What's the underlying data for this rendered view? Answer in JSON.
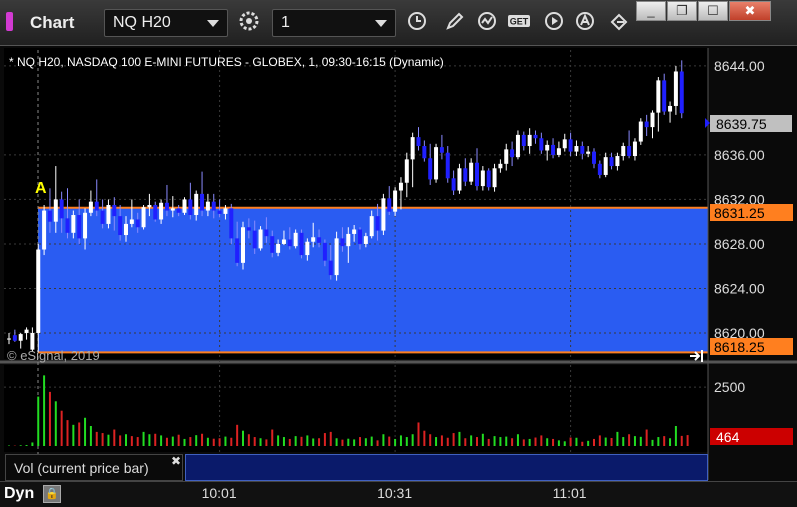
{
  "window": {
    "title": "Chart",
    "symbol": "NQ H20",
    "interval": "1",
    "buttons": [
      "_",
      "❐",
      "☐",
      "✖"
    ]
  },
  "chart": {
    "header": "* NQ H20, NASDAQ 100 E-MINI FUTURES - GLOBEX, 1, 09:30-16:15 (Dynamic)",
    "copyright": "© eSignal, 2019",
    "marker": "A",
    "last_price": "8639.75",
    "upper_level": "8631.25",
    "lower_level": "8618.25",
    "volume_label": "Vol (current price bar)",
    "volume_value": "464",
    "mode": "Dyn",
    "colors": {
      "up": "#ffffff",
      "down": "#2020ff",
      "band": "#2a5cf2",
      "level": "#ff7f1f",
      "vol_up": "#22dd22",
      "vol_down": "#dd2222",
      "last": "#c0c0c0"
    }
  },
  "chart_data": {
    "type": "candlestick",
    "price_axis": {
      "ticks": [
        8620,
        8624,
        8628,
        8632,
        8636,
        8644
      ],
      "labels": [
        "8620.00",
        "8624.00",
        "8628.00",
        "8632.00",
        "8636.00",
        "8644.00"
      ],
      "range": [
        8617.75,
        8645.25
      ]
    },
    "volume_axis": {
      "ticks": [
        2500
      ],
      "labels": [
        "2500"
      ],
      "range": [
        0,
        3400
      ]
    },
    "time_axis": {
      "labels": [
        "10:01",
        "10:31",
        "11:01"
      ],
      "bar_index": [
        36,
        66,
        96
      ]
    },
    "bars": [
      [
        8619.5,
        8620,
        8619,
        8619.5
      ],
      [
        8619.8,
        8620.3,
        8619.2,
        8619.3
      ],
      [
        8619.3,
        8620,
        8618.6,
        8619.9
      ],
      [
        8620,
        8620.5,
        8619.4,
        8620.3
      ],
      [
        8618.5,
        8620.5,
        8618.3,
        8620
      ],
      [
        8620,
        8628,
        8618.25,
        8627.5
      ],
      [
        8627.5,
        8631.5,
        8627,
        8631
      ],
      [
        8631,
        8633,
        8629,
        8630
      ],
      [
        8630,
        8635,
        8629,
        8632
      ],
      [
        8632,
        8632.7,
        8629,
        8630.3
      ],
      [
        8630.3,
        8633,
        8628.5,
        8629
      ],
      [
        8629,
        8631,
        8628.5,
        8630.6
      ],
      [
        8630.6,
        8632,
        8628,
        8628.5
      ],
      [
        8628.5,
        8631.2,
        8627.5,
        8630.8
      ],
      [
        8630.8,
        8632.8,
        8630.5,
        8631.8
      ],
      [
        8631.8,
        8633.8,
        8630.5,
        8631
      ],
      [
        8631,
        8632,
        8629.4,
        8629.8
      ],
      [
        8629.8,
        8632,
        8629.4,
        8631.5
      ],
      [
        8631.5,
        8632.2,
        8629.2,
        8630.5
      ],
      [
        8630.5,
        8631.5,
        8628.3,
        8628.8
      ],
      [
        8628.8,
        8630.5,
        8628.2,
        8629.8
      ],
      [
        8629.8,
        8632,
        8629.5,
        8630.2
      ],
      [
        8630.2,
        8630.8,
        8629,
        8629.5
      ],
      [
        8629.5,
        8631.5,
        8629.3,
        8631.3
      ],
      [
        8631.3,
        8632.5,
        8630.5,
        8631.5
      ],
      [
        8631.5,
        8631.8,
        8630,
        8630.2
      ],
      [
        8630.2,
        8632,
        8629.8,
        8631.7
      ],
      [
        8631.7,
        8633.3,
        8630.5,
        8631
      ],
      [
        8631,
        8632.3,
        8630.4,
        8631.2
      ],
      [
        8631.2,
        8631.5,
        8630.5,
        8630.8
      ],
      [
        8630.8,
        8632.2,
        8630.6,
        8632
      ],
      [
        8632,
        8633.5,
        8630.2,
        8630.6
      ],
      [
        8630.6,
        8632.8,
        8630.1,
        8632.5
      ],
      [
        8632.5,
        8634.5,
        8630.5,
        8631
      ],
      [
        8631,
        8632.5,
        8630.5,
        8631.8
      ],
      [
        8631.8,
        8632.5,
        8630.3,
        8631
      ],
      [
        8631,
        8632,
        8630.4,
        8630.7
      ],
      [
        8630.7,
        8631.5,
        8630.2,
        8631.2
      ],
      [
        8631.2,
        8631.6,
        8628,
        8628.5
      ],
      [
        8628.5,
        8630,
        8626,
        8626.3
      ],
      [
        8626.3,
        8630,
        8625.7,
        8629.5
      ],
      [
        8629.5,
        8630.3,
        8628.5,
        8629.2
      ],
      [
        8629.2,
        8630.1,
        8627.1,
        8627.6
      ],
      [
        8627.6,
        8629.6,
        8627.4,
        8629.3
      ],
      [
        8629.3,
        8630.4,
        8628.1,
        8628.7
      ],
      [
        8628.7,
        8629.2,
        8626.8,
        8627.2
      ],
      [
        8627.2,
        8628.4,
        8626.9,
        8628
      ],
      [
        8628,
        8629.2,
        8627.9,
        8628.4
      ],
      [
        8628.4,
        8629.5,
        8627.5,
        8627.8
      ],
      [
        8627.8,
        8629.3,
        8627.6,
        8629
      ],
      [
        8629,
        8629.3,
        8626.7,
        8627
      ],
      [
        8627,
        8628.5,
        8626.5,
        8628.2
      ],
      [
        8628.2,
        8629.9,
        8627.7,
        8628.6
      ],
      [
        8628.6,
        8629.3,
        8627.7,
        8628.1
      ],
      [
        8628.1,
        8628.4,
        8626,
        8626.5
      ],
      [
        8626.5,
        8627.9,
        8624.8,
        8625.2
      ],
      [
        8625.2,
        8629.1,
        8624.7,
        8628.5
      ],
      [
        8628.5,
        8629.5,
        8627.3,
        8627.8
      ],
      [
        8627.8,
        8629.5,
        8626.3,
        8628.9
      ],
      [
        8628.9,
        8629.7,
        8628.2,
        8629.3
      ],
      [
        8629.3,
        8629.5,
        8627.5,
        8628
      ],
      [
        8628,
        8629,
        8627.7,
        8628.7
      ],
      [
        8628.7,
        8631,
        8628.5,
        8630.5
      ],
      [
        8630.5,
        8631.6,
        8628.3,
        8629.2
      ],
      [
        8629.2,
        8632.5,
        8628.8,
        8632.1
      ],
      [
        8632.1,
        8633.2,
        8630.6,
        8630.9
      ],
      [
        8630.9,
        8633.1,
        8630.5,
        8632.8
      ],
      [
        8632.8,
        8634,
        8631.1,
        8633.5
      ],
      [
        8633.5,
        8636.2,
        8632.2,
        8635.6
      ],
      [
        8635.6,
        8638,
        8633.1,
        8637.6
      ],
      [
        8637.6,
        8638.5,
        8636.4,
        8636.8
      ],
      [
        8636.8,
        8637.3,
        8635.4,
        8635.7
      ],
      [
        8635.7,
        8637,
        8633.3,
        8633.8
      ],
      [
        8633.8,
        8637,
        8633.5,
        8636.7
      ],
      [
        8636.7,
        8637.8,
        8635.6,
        8636.2
      ],
      [
        8636.2,
        8636.8,
        8633.5,
        8633.9
      ],
      [
        8633.9,
        8634.6,
        8632.4,
        8632.8
      ],
      [
        8632.8,
        8635.2,
        8632.5,
        8634.8
      ],
      [
        8634.8,
        8635.7,
        8633.2,
        8633.6
      ],
      [
        8633.6,
        8635.7,
        8633.3,
        8635.3
      ],
      [
        8635.3,
        8636.6,
        8632.8,
        8633.2
      ],
      [
        8633.2,
        8635,
        8632.8,
        8634.6
      ],
      [
        8634.6,
        8634.8,
        8632.8,
        8633.1
      ],
      [
        8633.1,
        8635.2,
        8632.7,
        8634.8
      ],
      [
        8634.8,
        8635.6,
        8634.4,
        8635.2
      ],
      [
        8635.2,
        8637,
        8634.6,
        8636.5
      ],
      [
        8636.5,
        8637.2,
        8635,
        8635.8
      ],
      [
        8635.8,
        8638.2,
        8635.6,
        8637.8
      ],
      [
        8637.8,
        8638.1,
        8636.4,
        8636.8
      ],
      [
        8636.8,
        8638.4,
        8636.1,
        8637.8
      ],
      [
        8637.8,
        8638.2,
        8637,
        8637.5
      ],
      [
        8637.5,
        8638,
        8636.1,
        8636.4
      ],
      [
        8636.4,
        8637.3,
        8635.5,
        8636.9
      ],
      [
        8636.9,
        8637.5,
        8635.7,
        8636
      ],
      [
        8636,
        8637.2,
        8635.8,
        8636.6
      ],
      [
        8636.6,
        8637.9,
        8636.3,
        8637.4
      ],
      [
        8637.4,
        8638,
        8635.9,
        8636.3
      ],
      [
        8636.3,
        8637.3,
        8635.9,
        8636.8
      ],
      [
        8636.8,
        8637.2,
        8635.6,
        8636.1
      ],
      [
        8636.1,
        8636.8,
        8635.8,
        8636.3
      ],
      [
        8636.3,
        8636.6,
        8634.8,
        8635.2
      ],
      [
        8635.2,
        8635.5,
        8633.9,
        8634.2
      ],
      [
        8634.2,
        8636.2,
        8634,
        8635.8
      ],
      [
        8635.8,
        8636.2,
        8634.7,
        8635
      ],
      [
        8635,
        8636.2,
        8634.6,
        8635.9
      ],
      [
        8635.9,
        8637.1,
        8635.5,
        8636.8
      ],
      [
        8636.8,
        8638.2,
        8635.7,
        8635.9
      ],
      [
        8635.9,
        8637.5,
        8635.5,
        8637.2
      ],
      [
        8637.2,
        8639.3,
        8636.9,
        8639
      ],
      [
        8639,
        8639.6,
        8637.7,
        8638.5
      ],
      [
        8638.5,
        8640,
        8637.5,
        8639.8
      ],
      [
        8639.8,
        8643,
        8638.1,
        8642.7
      ],
      [
        8642.7,
        8643.3,
        8639.6,
        8639.9
      ],
      [
        8639.9,
        8640.8,
        8638.9,
        8640.4
      ],
      [
        8640.4,
        8644,
        8639.6,
        8643.5
      ],
      [
        8643.5,
        8644.5,
        8639.3,
        8639.75
      ]
    ],
    "volume": [
      20,
      15,
      30,
      40,
      150,
      2100,
      3000,
      2300,
      1900,
      1500,
      1100,
      900,
      1000,
      1200,
      850,
      600,
      550,
      480,
      700,
      450,
      500,
      420,
      380,
      600,
      500,
      520,
      450,
      350,
      400,
      480,
      300,
      380,
      460,
      520,
      350,
      310,
      330,
      400,
      350,
      900,
      650,
      500,
      380,
      330,
      280,
      700,
      450,
      380,
      300,
      420,
      390,
      450,
      320,
      330,
      550,
      600,
      330,
      270,
      310,
      280,
      380,
      330,
      400,
      240,
      500,
      400,
      300,
      450,
      380,
      500,
      1000,
      650,
      500,
      380,
      450,
      350,
      550,
      600,
      330,
      450,
      380,
      520,
      300,
      420,
      380,
      400,
      330,
      500,
      280,
      300,
      360,
      450,
      330,
      300,
      240,
      200,
      360,
      350,
      180,
      220,
      300,
      450,
      360,
      340,
      600,
      380,
      500,
      420,
      390,
      700,
      260,
      380,
      420,
      330,
      850,
      430,
      464
    ],
    "volume_up": [
      true,
      false,
      true,
      true,
      true,
      true,
      true,
      false,
      true,
      false,
      false,
      true,
      false,
      true,
      true,
      false,
      false,
      true,
      false,
      false,
      true,
      false,
      false,
      true,
      true,
      false,
      true,
      false,
      true,
      false,
      true,
      false,
      true,
      false,
      true,
      false,
      false,
      true,
      false,
      false,
      true,
      false,
      false,
      true,
      false,
      false,
      true,
      true,
      false,
      true,
      false,
      true,
      true,
      false,
      false,
      false,
      true,
      false,
      true,
      true,
      false,
      true,
      true,
      false,
      true,
      false,
      true,
      true,
      true,
      true,
      false,
      false,
      false,
      true,
      false,
      false,
      false,
      true,
      false,
      true,
      false,
      true,
      false,
      true,
      true,
      true,
      false,
      true,
      false,
      true,
      false,
      false,
      true,
      false,
      true,
      true,
      false,
      true,
      false,
      true,
      false,
      false,
      true,
      false,
      true,
      true,
      false,
      true,
      true,
      false,
      true,
      true,
      false,
      true,
      true,
      false
    ]
  }
}
